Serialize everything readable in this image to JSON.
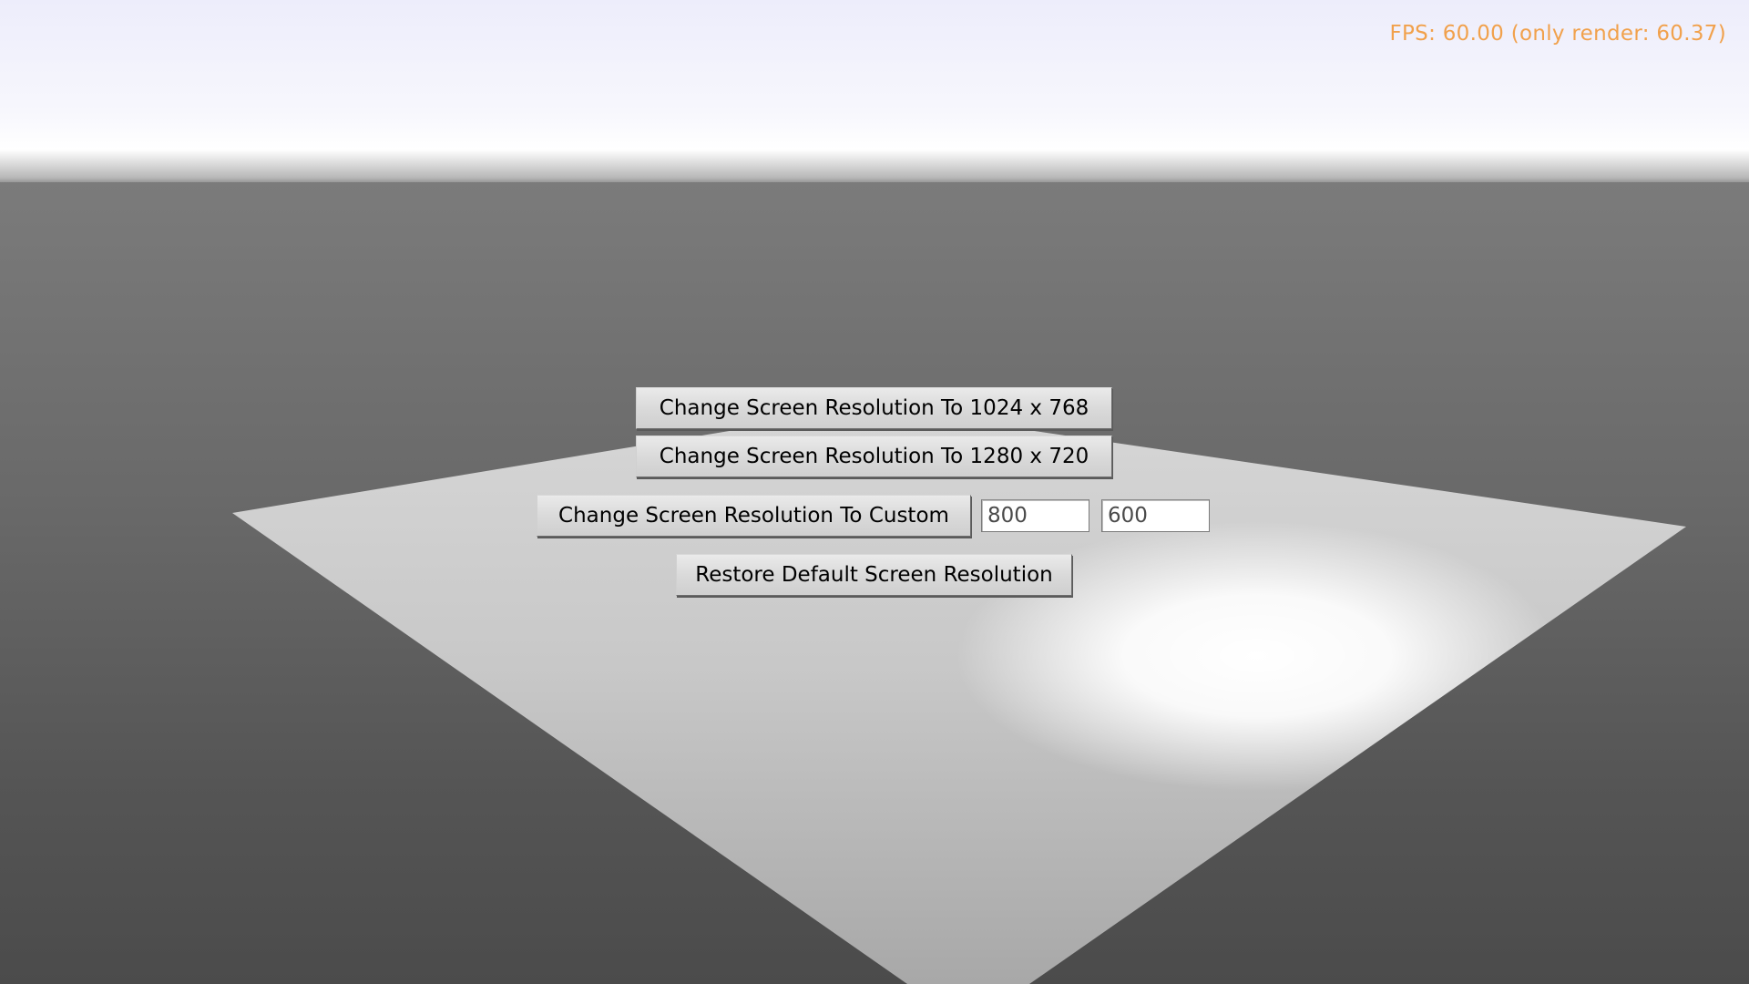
{
  "fps_overlay": {
    "text": "FPS: 60.00 (only render: 60.37)",
    "color": "#f1a14c"
  },
  "buttons": {
    "res_1024": "Change Screen Resolution To 1024 x 768",
    "res_1280": "Change Screen Resolution To 1280 x 720",
    "res_custom": "Change Screen Resolution To Custom",
    "restore": "Restore Default Screen Resolution"
  },
  "custom_resolution": {
    "width_value": "800",
    "height_value": "600"
  }
}
